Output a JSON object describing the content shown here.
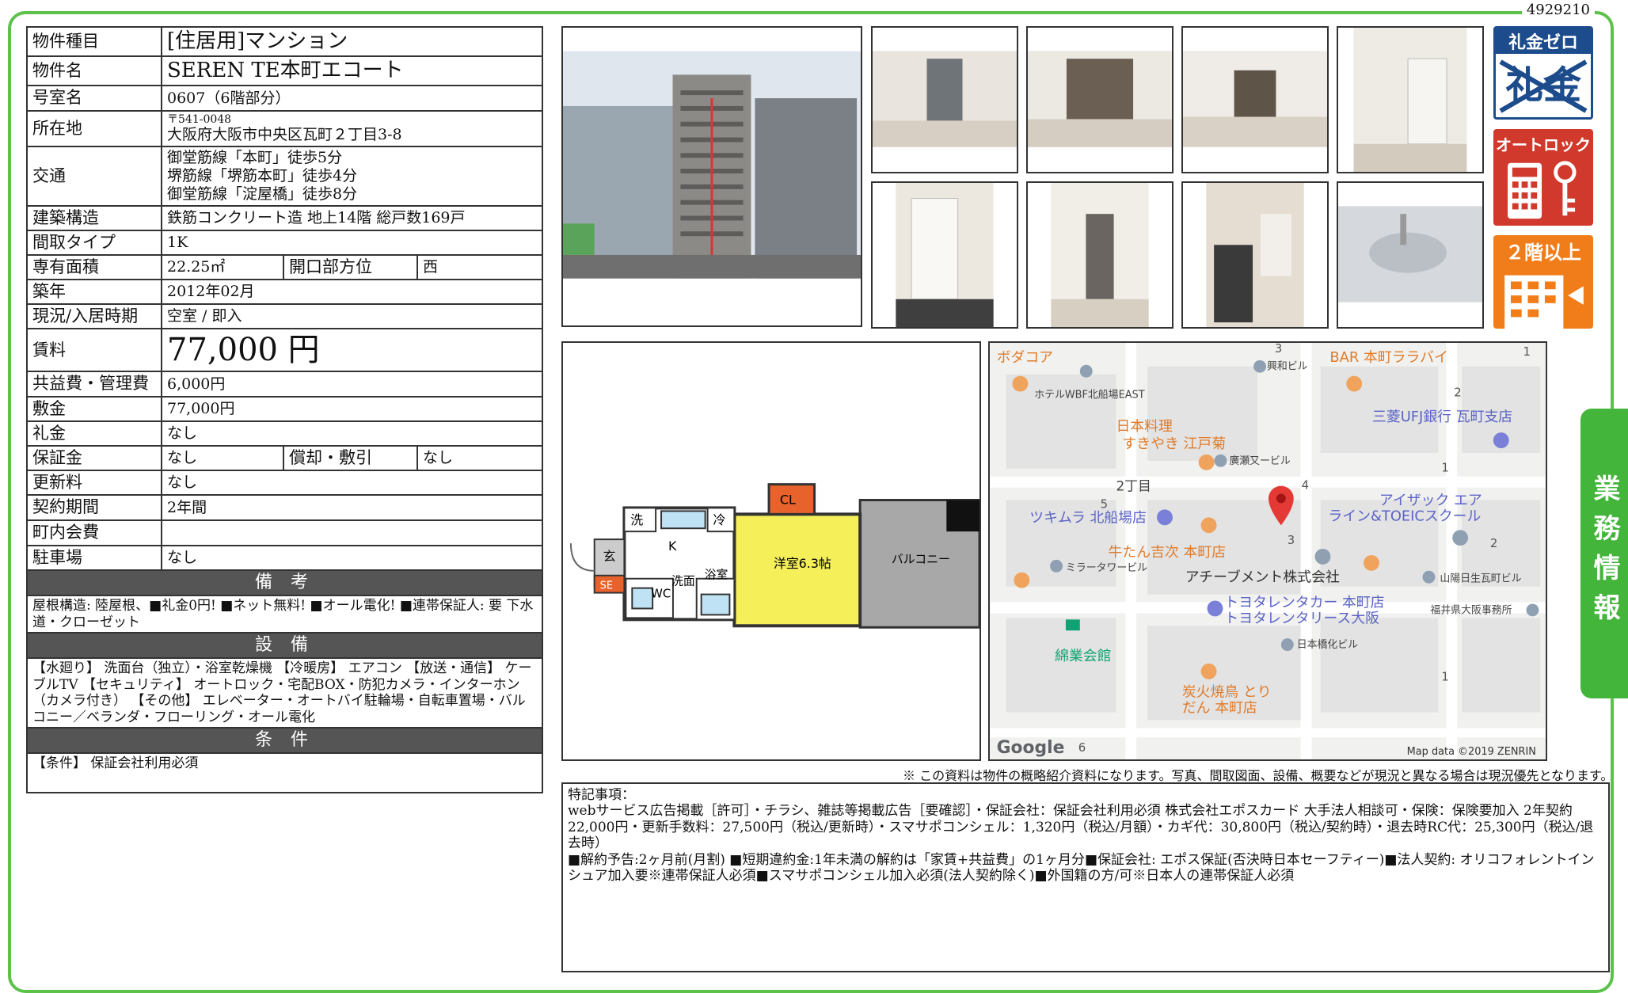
{
  "doc_id": "4929210",
  "fields": {
    "type_label": "物件種目",
    "type_value": "[住居用]マンション",
    "name_label": "物件名",
    "name_value": "SEREN TE本町エコート",
    "room_label": "号室名",
    "room_value": "0607（6階部分）",
    "address_label": "所在地",
    "postal": "〒541-0048",
    "address": "大阪府大阪市中央区瓦町２丁目3-8",
    "transit_label": "交通",
    "transit": [
      "御堂筋線「本町」徒歩5分",
      "堺筋線「堺筋本町」徒歩4分",
      "御堂筋線「淀屋橋」徒歩8分"
    ],
    "structure_label": "建築構造",
    "structure_value": "鉄筋コンクリート造 地上14階 総戸数169戸",
    "layout_label": "間取タイプ",
    "layout_value": "1K",
    "area_label": "専有面積",
    "area_value": "22.25㎡",
    "direction_label": "開口部方位",
    "direction_value": "西",
    "built_label": "築年",
    "built_value": "2012年02月",
    "status_label": "現況/入居時期",
    "status_value": "空室 / 即入",
    "rent_label": "賃料",
    "rent_value": "77,000 円",
    "fee_label": "共益費・管理費",
    "fee_value": "6,000円",
    "deposit_label": "敷金",
    "deposit_value": "77,000円",
    "key_label": "礼金",
    "key_value": "なし",
    "guarantee_label": "保証金",
    "guarantee_value": "なし",
    "amort_label": "償却・敷引",
    "amort_value": "なし",
    "renewal_label": "更新料",
    "renewal_value": "なし",
    "period_label": "契約期間",
    "period_value": "2年間",
    "town_label": "町内会費",
    "town_value": "",
    "parking_label": "駐車場",
    "parking_value": "なし"
  },
  "sections": {
    "remarks_title": "備 考",
    "remarks": "屋根構造: 陸屋根、■礼金0円! ■ネット無料! ■オール電化! ■連帯保証人: 要 下水道・クローゼット",
    "equipment_title": "設 備",
    "equipment": "【水廻り】 洗面台（独立）・浴室乾燥機 【冷暖房】 エアコン 【放送・通信】 ケーブルTV 【セキュリティ】 オートロック・宅配BOX・防犯カメラ・インターホン（カメラ付き） 【その他】 エレベーター・オートバイ駐輪場・自転車置場・バルコニー／ベランダ・フローリング・オール電化",
    "conditions_title": "条 件",
    "conditions": "【条件】 保証会社利用必須"
  },
  "badges": {
    "b1_top": "礼金ゼロ",
    "b1_bottom": "礼金",
    "b2_top": "オートロック",
    "b3_top": "２階以上"
  },
  "side_tab": "業務情報",
  "floorplan": {
    "wash": "洗",
    "fridge": "冷",
    "cl": "CL",
    "entry": "玄",
    "k": "K",
    "se": "SE",
    "washroom": "洗面",
    "bath": "浴室",
    "wc": "WC",
    "room": "洋室6.3帖",
    "balcony": "バルコニー"
  },
  "map": {
    "labels": [
      "ボダコア",
      "興和ビル",
      "BAR 本町ララバイ",
      "ホテルWBF北船場EAST",
      "日本料理",
      "すきやき 江戸菊",
      "廣瀬又ービル",
      "三菱UFJ銀行 瓦町支店",
      "2丁目",
      "アイザック エア",
      "ライン&TOEICスクール",
      "ツキムラ 北船場店",
      "牛たん吉次 本町店",
      "ミラータワービル",
      "アチーブメント株式会社",
      "山陽日生瓦町ビル",
      "トヨタレンタカー 本町店",
      "トヨタレンタリース大阪",
      "福井県大阪事務所",
      "綿業会館",
      "日本橋化ビル",
      "炭火焼鳥 とり",
      "だん 本町店"
    ],
    "numbers": [
      "3",
      "2",
      "1",
      "5",
      "4",
      "3",
      "2",
      "1",
      "6",
      "1"
    ],
    "google": "Google",
    "attribution": "Map data ©2019 ZENRIN"
  },
  "disclaimer": "※ この資料は物件の概略紹介資料になります。写真、間取図面、設備、概要などが現況と異なる場合は現況優先となります。",
  "special": {
    "title": "特記事項：",
    "line1": "webサービス広告掲載［許可］・チラシ、雑誌等掲載広告［要確認］・保証会社：保証会社利用必須 株式会社エポスカード 大手法人相談可・保険：保険要加入 2年契約 22,000円・更新手数料：27,500円（税込/更新時）・スマサポコンシェル：1,320円（税込/月額）・カギ代：30,800円（税込/契約時）・退去時RC代：25,300円（税込/退去時）",
    "line2": "■解約予告:2ヶ月前(月割) ■短期違約金:1年未満の解約は「家賃+共益費」の1ヶ月分■保証会社: エポス保証(否決時日本セーフティー)■法人契約: オリコフォレントインシュア加入要※連帯保証人必須■スマサポコンシェル加入必須(法人契約除く)■外国籍の方/可※日本人の連帯保証人必須"
  },
  "colors": {
    "frame": "#5cc24a",
    "side_tab": "#43b53a",
    "section_bar": "#555555",
    "badge_blue": "#1d4c8c",
    "badge_red": "#d0392b",
    "badge_orange": "#f07d1a",
    "floor_yellow": "#f5ef5a",
    "floor_orange": "#e8622c"
  }
}
